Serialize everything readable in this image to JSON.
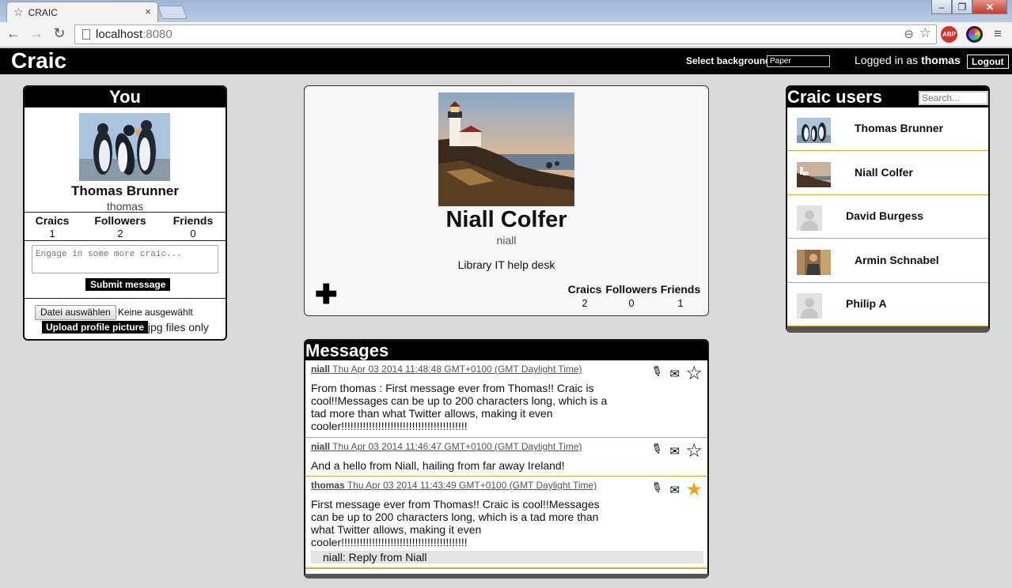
{
  "browser": {
    "tab_title": "CRAIC",
    "tab_close": "×",
    "url_host": "localhost",
    "url_port": ":8080",
    "abp_label": "ABP"
  },
  "header": {
    "logo": "Craic",
    "bg_label": "Select background:",
    "bg_value": "Paper",
    "logged_prefix": "Logged in as",
    "username": "thomas",
    "logout": "Logout"
  },
  "you": {
    "title": "You",
    "name": "Thomas Brunner",
    "handle": "thomas",
    "stats": [
      {
        "label": "Craics",
        "value": "1"
      },
      {
        "label": "Followers",
        "value": "2"
      },
      {
        "label": "Friends",
        "value": "0"
      }
    ],
    "input_placeholder": "Engage in some more craic...",
    "submit_label": "Submit message",
    "file_button": "Datei auswählen",
    "file_status": "Keine ausgewählt",
    "upload_label": "Upload profile picture",
    "upload_note": ".jpg files only"
  },
  "profile": {
    "name": "Niall Colfer",
    "handle": "niall",
    "bio": "Library IT help desk",
    "follow_symbol": "✚",
    "stats": [
      {
        "label": "Craics",
        "value": "2"
      },
      {
        "label": "Followers",
        "value": "0"
      },
      {
        "label": "Friends",
        "value": "1"
      }
    ]
  },
  "messages": {
    "title": "Messages",
    "items": [
      {
        "user": "niall",
        "date": "Thu Apr 03 2014 11:48:48 GMT+0100 (GMT Daylight Time)",
        "text": "From thomas : First message ever from Thomas!! Craic is cool!!Messages can be up to 200 characters long, which is a tad more than what Twitter allows, making it even cooler!!!!!!!!!!!!!!!!!!!!!!!!!!!!!!!!!!!!!!!!!",
        "starred": false
      },
      {
        "user": "niall",
        "date": "Thu Apr 03 2014 11:46:47 GMT+0100 (GMT Daylight Time)",
        "text": "And a hello from Niall, hailing from far away Ireland!",
        "starred": false
      },
      {
        "user": "thomas",
        "date": "Thu Apr 03 2014 11:43:49 GMT+0100 (GMT Daylight Time)",
        "text": "First message ever from Thomas!! Craic is cool!!Messages can be up to 200 characters long, which is a tad more than what Twitter allows, making it even cooler!!!!!!!!!!!!!!!!!!!!!!!!!!!!!!!!!!!!!!!!!",
        "starred": true,
        "reply": "niall: Reply from Niall"
      }
    ]
  },
  "users": {
    "title": "Craic users",
    "search_placeholder": "Search...",
    "list": [
      {
        "name": "Thomas Brunner",
        "avatar": "penguins"
      },
      {
        "name": "Niall Colfer",
        "avatar": "lighthouse"
      },
      {
        "name": "David Burgess",
        "avatar": "default"
      },
      {
        "name": "Armin Schnabel",
        "avatar": "person"
      },
      {
        "name": "Philip A",
        "avatar": "default"
      }
    ]
  }
}
